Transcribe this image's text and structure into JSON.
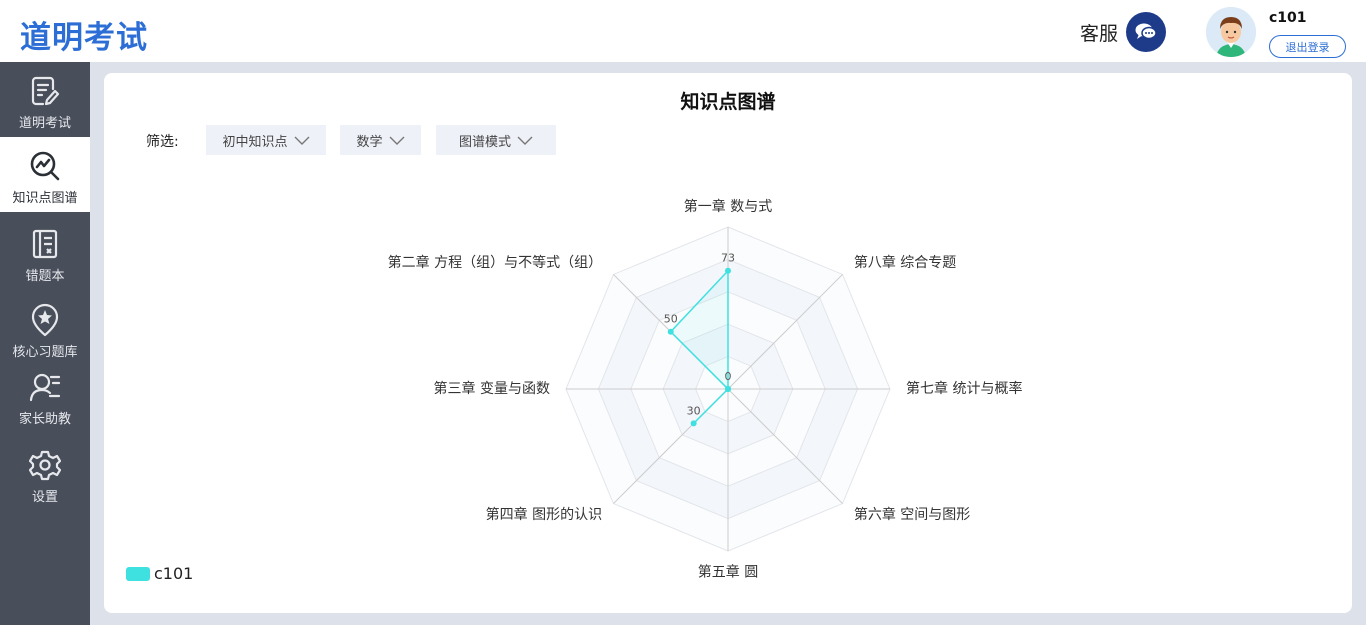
{
  "app": {
    "title": "道明考试"
  },
  "header": {
    "service_label": "客服",
    "username": "c101",
    "logout_label": "退出登录"
  },
  "sidebar": {
    "items": [
      {
        "label": "道明考试",
        "icon": "exam-icon"
      },
      {
        "label": "知识点图谱",
        "icon": "graph-search-icon"
      },
      {
        "label": "错题本",
        "icon": "notebook-icon"
      },
      {
        "label": "核心习题库",
        "icon": "star-pin-icon"
      },
      {
        "label": "家长助教",
        "icon": "parent-user-icon"
      },
      {
        "label": "设置",
        "icon": "gear-icon"
      }
    ],
    "active_index": 1
  },
  "main": {
    "title": "知识点图谱",
    "filter_label": "筛选:",
    "filters": [
      {
        "value": "初中知识点"
      },
      {
        "value": "数学"
      },
      {
        "value": "图谱模式"
      }
    ]
  },
  "colors": {
    "brand": "#2d6ed6",
    "sidebar_bg": "#484e5a",
    "series": "#3fe0e0"
  },
  "chart_data": {
    "type": "radar",
    "indicators": [
      "第一章 数与式",
      "第八章 综合专题",
      "第七章 统计与概率",
      "第六章 空间与图形",
      "第五章  圆",
      "第四章 图形的认识",
      "第三章  变量与函数",
      "第二章  方程（组）与不等式（组）"
    ],
    "max": 100,
    "split_number": 5,
    "series": [
      {
        "name": "c101",
        "values": [
          73,
          0,
          0,
          0,
          0,
          30,
          0,
          50
        ],
        "labels": [
          "73",
          "",
          "",
          "",
          "",
          "30",
          "0",
          "50"
        ]
      }
    ],
    "legend_position": "bottom-left"
  }
}
